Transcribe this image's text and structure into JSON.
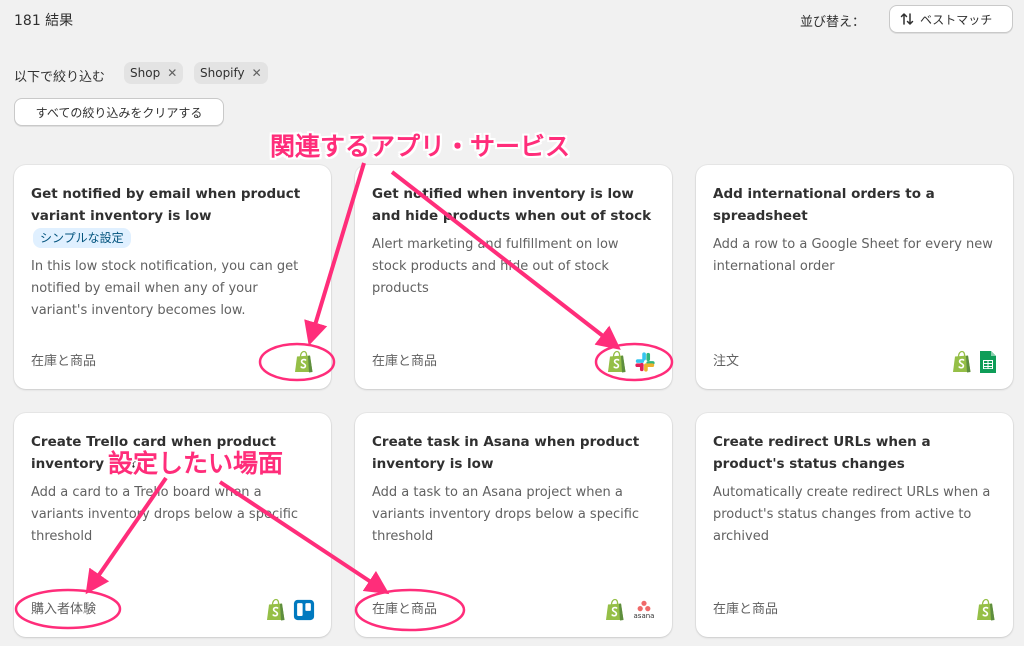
{
  "header": {
    "result_count": "181 結果",
    "sort_label": "並び替え：",
    "sort_button": "ベストマッチ"
  },
  "filters": {
    "label": "以下で絞り込む",
    "tags": [
      "Shop",
      "Shopify"
    ],
    "clear_button": "すべての絞り込みをクリアする"
  },
  "cards": [
    {
      "title": "Get notified by email when product variant inventory is low",
      "badge": "シンプルな設定",
      "description": "In this low stock notification, you can get notified by email when any of your variant's inventory becomes low.",
      "category": "在庫と商品",
      "icons": [
        "shopify-icon"
      ]
    },
    {
      "title": "Get notified when inventory is low and hide products when out of stock",
      "description": "Alert marketing and fulfillment on low stock products and hide out of stock products",
      "category": "在庫と商品",
      "icons": [
        "shopify-icon",
        "slack-icon"
      ]
    },
    {
      "title": "Add international orders to a spreadsheet",
      "description": "Add a row to a Google Sheet for every new international order",
      "category": "注文",
      "icons": [
        "shopify-icon",
        "google-sheets-icon"
      ]
    },
    {
      "title": "Create Trello card when product inventory is low",
      "description": "Add a card to a Trello board when a variants inventory drops below a specific threshold",
      "category": "購入者体験",
      "icons": [
        "shopify-icon",
        "trello-icon"
      ]
    },
    {
      "title": "Create task in Asana when product inventory is low",
      "description": "Add a task to an Asana project when a variants inventory drops below a specific threshold",
      "category": "在庫と商品",
      "icons": [
        "shopify-icon",
        "asana-icon"
      ],
      "asana_text": "asana"
    },
    {
      "title": "Create redirect URLs when a product's status changes",
      "description": "Automatically create redirect URLs when a product's status changes from active to archived",
      "category": "在庫と商品",
      "icons": [
        "shopify-icon"
      ]
    }
  ],
  "annotations": {
    "related_apps": "関連するアプリ・サービス",
    "target_scene": "設定したい場面",
    "color": "#ff2d7a"
  },
  "colors": {
    "shopify_green": "#95bf47",
    "sheets_green": "#0f9d58",
    "trello_blue": "#0079bf",
    "asana_coral": "#f06a6a"
  }
}
